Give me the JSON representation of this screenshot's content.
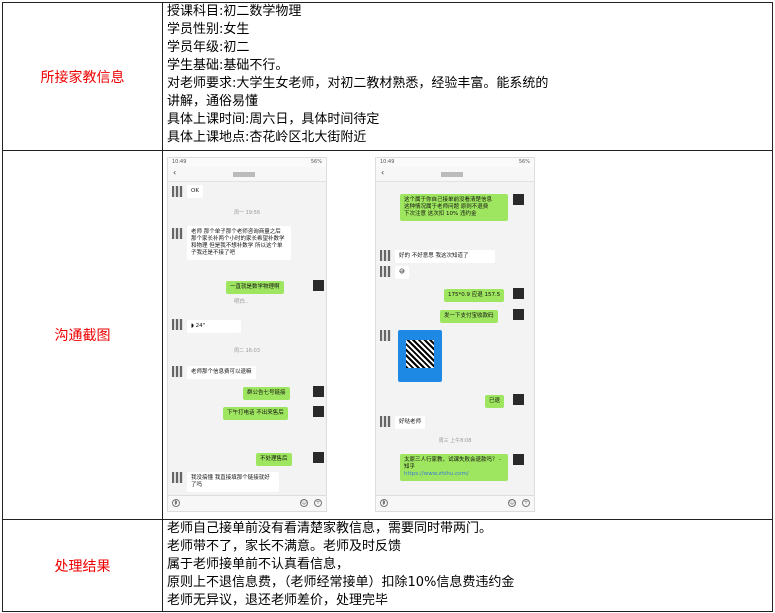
{
  "rows": {
    "info": {
      "label": "所接家教信息",
      "lines": [
        "授课科目:初二数学物理",
        "学员性别:女生",
        "学员年级:初二",
        "学生基础:基础不行。",
        "对老师要求:大学生女老师，对初二教材熟悉，经验丰富。能系统的",
        "讲解，通俗易懂",
        "具体上课时间:周六日，具体时间待定",
        "具体上课地点:杏花岭区北大街附近"
      ]
    },
    "screens": {
      "label": "沟通截图",
      "phone1": {
        "status": "10:49",
        "battery": "56%",
        "msgs": [
          "OK",
          "老师 那个单子那个老师咨询商量之后 那个家长补两个小时的家长希望补数学和物理 但是我不想补数学 所以这个单子我还是不接了吧",
          "一直就是数学物理啊",
          "明白..",
          "24\"",
          "老师那个信息费可以退嘛",
          "群公告七号链接",
          "下午打电话 不出来售后",
          "不处理售后",
          "我没搞懂 我直接填那个链接就好了吗"
        ],
        "times": [
          "周一 19:56",
          "周二 16:03"
        ]
      },
      "phone2": {
        "status": "10:49",
        "battery": "56%",
        "msgs": [
          "这个属于你自己接单前没看清楚信息",
          "这种情况属于老师问题 原则不退费",
          "下次注意 这次扣 10% 违约金",
          "好的 不好意思 我这次知道了",
          "175*0.9 应退 157.5",
          "发一下支付宝收款码",
          "已退",
          "好哒老师",
          "太原三人行家教，试课失败会退款吗？ - 知乎",
          "https://www.zhihu.com/"
        ],
        "times": [
          "周三 上午8:08"
        ]
      }
    },
    "result": {
      "label": "处理结果",
      "lines": [
        "老师自己接单前没有看清楚家教信息，需要同时带两门。",
        "老师带不了，家长不满意。老师及时反馈",
        "属于老师接单前不认真看信息，",
        "原则上不退信息费，（老师经常接单）扣除10%信息费违约金",
        "老师无异议，退还老师差价，处理完毕"
      ]
    }
  }
}
